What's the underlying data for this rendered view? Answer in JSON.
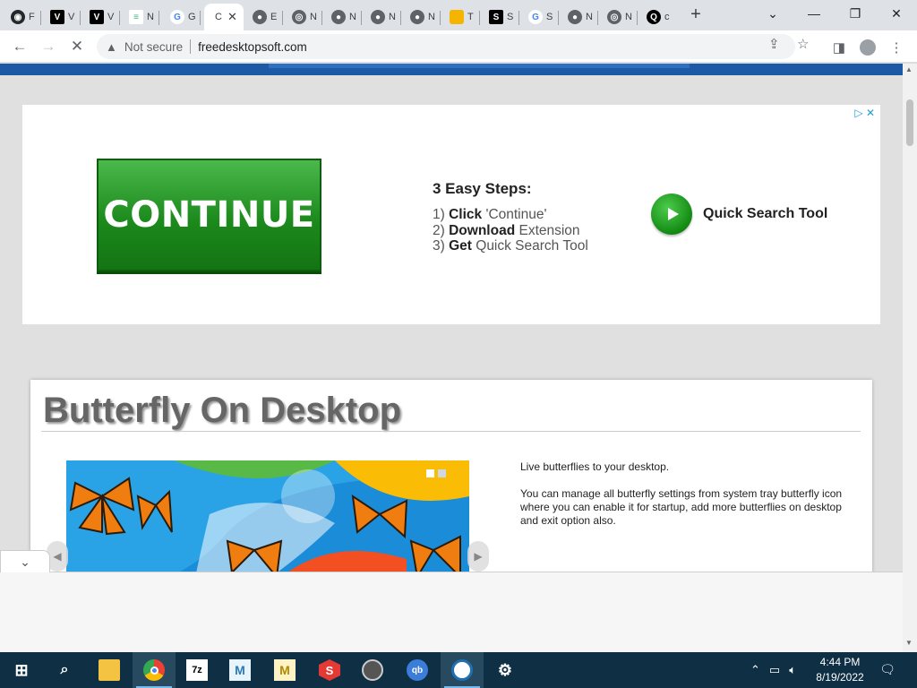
{
  "browser": {
    "tabs": [
      {
        "icon": "github-icon",
        "title": "F",
        "color": "#24292e"
      },
      {
        "icon": "v-icon",
        "title": "V",
        "color": "#000000"
      },
      {
        "icon": "v-icon",
        "title": "V",
        "color": "#000000"
      },
      {
        "icon": "lines-icon",
        "title": "N",
        "color": "#3fb27f"
      },
      {
        "icon": "google-icon",
        "title": "G",
        "color": "#4285f4"
      },
      {
        "icon": "globe-icon",
        "title": "C",
        "color": "#5f6368",
        "active": true
      },
      {
        "icon": "globe-icon",
        "title": "E",
        "color": "#5f6368"
      },
      {
        "icon": "chrome-icon",
        "title": "N",
        "color": "#5f6368"
      },
      {
        "icon": "globe-icon",
        "title": "N",
        "color": "#5f6368"
      },
      {
        "icon": "globe-icon",
        "title": "N",
        "color": "#5f6368"
      },
      {
        "icon": "globe-icon",
        "title": "N",
        "color": "#5f6368"
      },
      {
        "icon": "folder-icon",
        "title": "T",
        "color": "#f4b400"
      },
      {
        "icon": "s-icon",
        "title": "S",
        "color": "#000000"
      },
      {
        "icon": "google-icon",
        "title": "S",
        "color": "#4285f4"
      },
      {
        "icon": "globe-icon",
        "title": "N",
        "color": "#5f6368"
      },
      {
        "icon": "chrome-icon",
        "title": "N",
        "color": "#5f6368"
      },
      {
        "icon": "q-icon",
        "title": "c",
        "color": "#000000"
      }
    ],
    "security_label": "Not secure",
    "url": "freedesktopsoft.com"
  },
  "ad": {
    "continue_label": "CONTINUE",
    "steps_heading": "3 Easy Steps:",
    "steps": [
      {
        "num": "1)",
        "bold": "Click",
        "rest": " 'Continue'"
      },
      {
        "num": "2)",
        "bold": "Download",
        "rest": " Extension"
      },
      {
        "num": "3)",
        "bold": "Get",
        "rest": " Quick Search Tool"
      }
    ],
    "product_label": "Quick Search Tool",
    "adchoices": "▷ ✕",
    "accent": "#1c8a1c"
  },
  "article": {
    "title": "Butterfly On Desktop",
    "desc_line1": "Live butterflies to your desktop.",
    "desc_line2": "You can manage all butterfly settings from system tray butterfly icon where you can enable it for startup, add more butterflies on desktop and exit option also."
  },
  "taskbar": {
    "time": "4:44 PM",
    "date": "8/19/2022",
    "apps": [
      "file-explorer-icon",
      "chrome-icon",
      "7zip-icon",
      "m-app-icon",
      "m-app-icon",
      "s-app-icon",
      "inkscape-icon",
      "qbittorrent-icon",
      "sync-app-icon",
      "settings-icon"
    ]
  }
}
